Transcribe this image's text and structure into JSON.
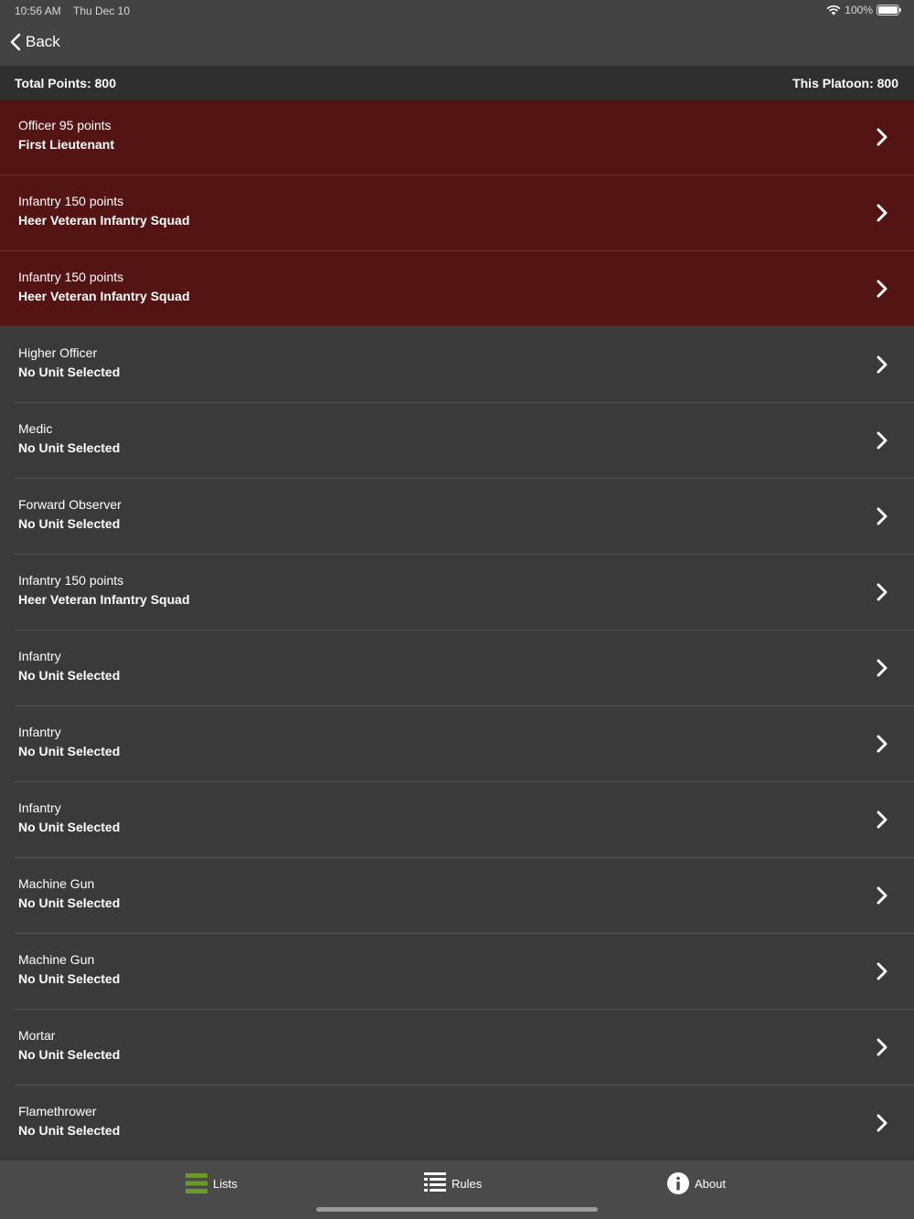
{
  "status": {
    "time": "10:56 AM",
    "date": "Thu Dec 10",
    "battery": "100%"
  },
  "nav": {
    "back_label": "Back"
  },
  "points": {
    "total": "Total Points: 800",
    "platoon": "This Platoon: 800"
  },
  "rows": [
    {
      "title": "Officer  95 points",
      "subtitle": "First Lieutenant",
      "selected": true
    },
    {
      "title": "Infantry  150 points",
      "subtitle": "Heer Veteran Infantry Squad",
      "selected": true
    },
    {
      "title": "Infantry  150 points",
      "subtitle": "Heer Veteran Infantry Squad",
      "selected": true
    },
    {
      "title": "Higher Officer",
      "subtitle": "No Unit Selected",
      "selected": false
    },
    {
      "title": "Medic",
      "subtitle": "No Unit Selected",
      "selected": false
    },
    {
      "title": "Forward Observer",
      "subtitle": "No Unit Selected",
      "selected": false
    },
    {
      "title": "Infantry  150 points",
      "subtitle": "Heer Veteran Infantry Squad",
      "selected": false
    },
    {
      "title": "Infantry",
      "subtitle": "No Unit Selected",
      "selected": false
    },
    {
      "title": "Infantry",
      "subtitle": "No Unit Selected",
      "selected": false
    },
    {
      "title": "Infantry",
      "subtitle": "No Unit Selected",
      "selected": false
    },
    {
      "title": "Machine Gun",
      "subtitle": "No Unit Selected",
      "selected": false
    },
    {
      "title": "Machine Gun",
      "subtitle": "No Unit Selected",
      "selected": false
    },
    {
      "title": "Mortar",
      "subtitle": "No Unit Selected",
      "selected": false
    },
    {
      "title": "Flamethrower",
      "subtitle": "No Unit Selected",
      "selected": false
    }
  ],
  "tabs": [
    {
      "label": "Lists",
      "icon": "list-green-icon",
      "active": true
    },
    {
      "label": "Rules",
      "icon": "rules-icon",
      "active": false
    },
    {
      "label": "About",
      "icon": "info-icon",
      "active": false
    }
  ],
  "colors": {
    "selected_row": "#541414",
    "active_tab": "#6a9a2a",
    "background": "#3a3a3a"
  }
}
